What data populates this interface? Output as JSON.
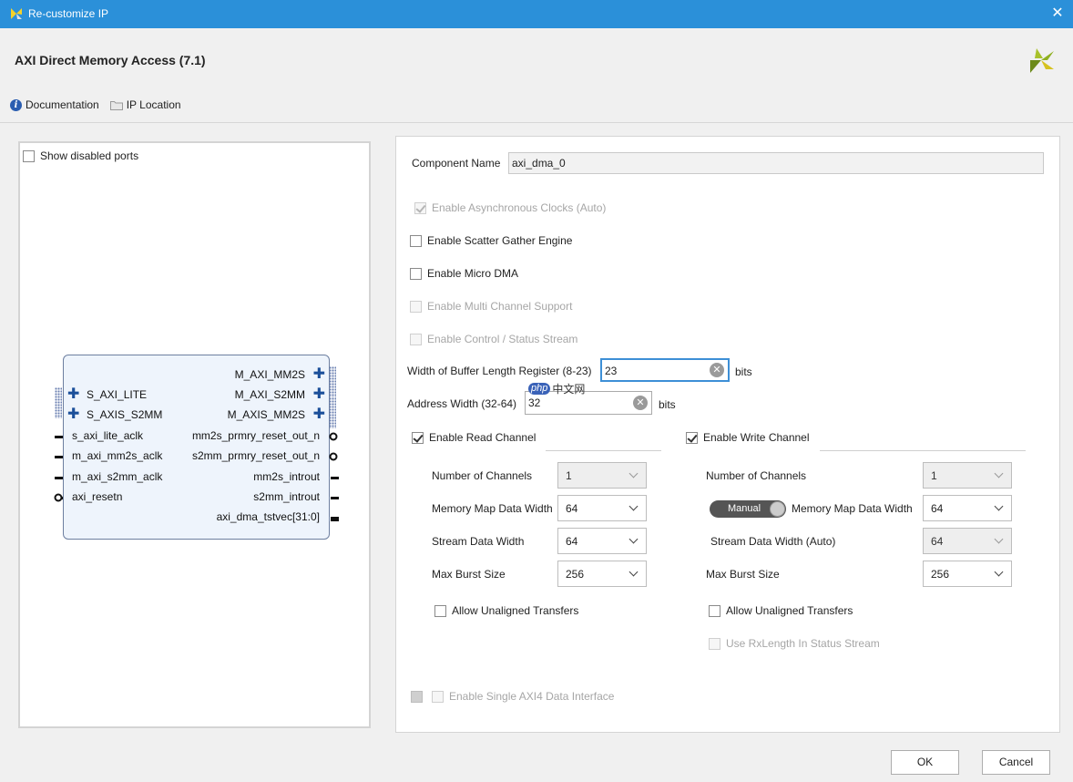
{
  "window": {
    "title": "Re-customize IP",
    "ip_title": "AXI Direct Memory Access (7.1)"
  },
  "toolbar": {
    "documentation_label": "Documentation",
    "ip_location_label": "IP Location"
  },
  "symbol_panel": {
    "show_disabled_ports": "Show disabled ports",
    "right_ports": [
      "M_AXI_MM2S",
      "M_AXI_S2MM",
      "M_AXIS_MM2S",
      "mm2s_prmry_reset_out_n",
      "s2mm_prmry_reset_out_n",
      "mm2s_introut",
      "s2mm_introut",
      "axi_dma_tstvec[31:0]"
    ],
    "left_ports": [
      "S_AXI_LITE",
      "S_AXIS_S2MM",
      "s_axi_lite_aclk",
      "m_axi_mm2s_aclk",
      "m_axi_s2mm_aclk",
      "axi_resetn"
    ]
  },
  "config": {
    "component_name_label": "Component Name",
    "component_name_value": "axi_dma_0",
    "async_clocks": "Enable Asynchronous Clocks (Auto)",
    "scatter_gather": "Enable Scatter Gather Engine",
    "micro_dma": "Enable Micro DMA",
    "multi_channel": "Enable Multi Channel Support",
    "control_status": "Enable Control / Status Stream",
    "buffer_length_label": "Width of Buffer Length Register (8-23)",
    "buffer_length_value": "23",
    "address_width_label": "Address Width (32-64)",
    "address_width_value": "32",
    "bits_label": "bits",
    "single_axi4": "Enable Single AXI4 Data Interface"
  },
  "read_channel": {
    "enable_label": "Enable Read Channel",
    "num_channels_label": "Number of Channels",
    "num_channels_value": "1",
    "mm_width_label": "Memory Map Data Width",
    "mm_width_value": "64",
    "stream_width_label": "Stream Data Width",
    "stream_width_value": "64",
    "burst_label": "Max Burst Size",
    "burst_value": "256",
    "unaligned_label": "Allow Unaligned Transfers"
  },
  "write_channel": {
    "enable_label": "Enable Write Channel",
    "num_channels_label": "Number of Channels",
    "num_channels_value": "1",
    "manual_label": "Manual",
    "mm_width_label": "Memory Map Data Width",
    "mm_width_value": "64",
    "stream_width_label": "Stream Data Width (Auto)",
    "stream_width_value": "64",
    "burst_label": "Max Burst Size",
    "burst_value": "256",
    "unaligned_label": "Allow Unaligned Transfers",
    "rxlength_label": "Use RxLength In Status Stream"
  },
  "watermark": {
    "badge": "php",
    "text": "中文网"
  },
  "buttons": {
    "ok": "OK",
    "cancel": "Cancel"
  },
  "colors": {
    "titlebar": "#2b90d9",
    "accent_input": "#3d8fd6",
    "block_fill": "#eef4fc"
  }
}
